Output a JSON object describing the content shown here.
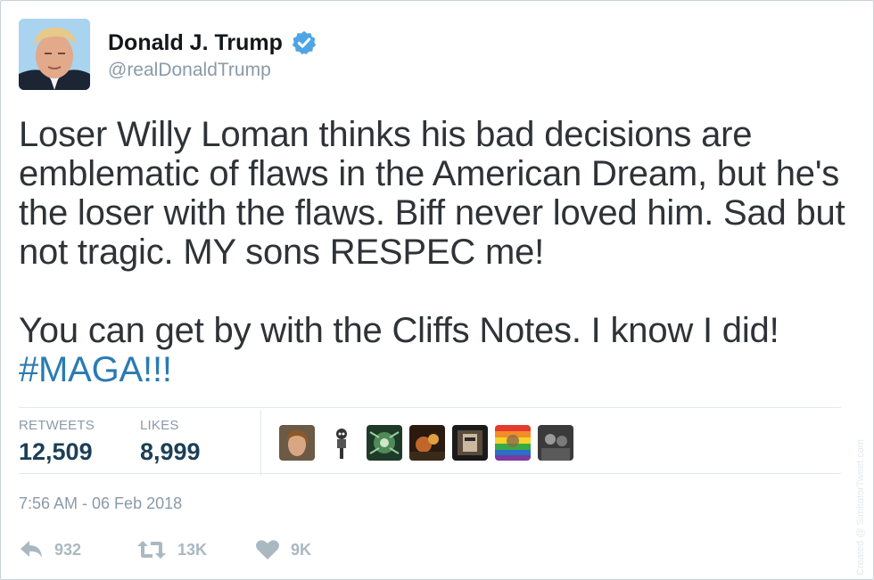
{
  "author": {
    "display_name": "Donald J. Trump",
    "handle": "@realDonaldTrump",
    "verified": true,
    "verified_icon": "verified-badge-icon",
    "verified_color": "#4ea4e4"
  },
  "tweet": {
    "paragraph1": "Loser Willy Loman thinks his bad decisions are emblematic of flaws in the American Dream, but he's the loser with the flaws. Biff never loved him. Sad but not tragic.  MY sons RESPEC me!",
    "paragraph2_text": "You can get by with the Cliffs Notes. I know I did!",
    "hashtag": "#MAGA!!!",
    "hashtag_color": "#2a7bb2"
  },
  "stats": {
    "retweets_label": "RETWEETS",
    "retweets_value": "12,509",
    "likes_label": "LIKES",
    "likes_value": "8,999"
  },
  "likers": [
    {
      "name": "liker-avatar-1"
    },
    {
      "name": "liker-avatar-2"
    },
    {
      "name": "liker-avatar-3"
    },
    {
      "name": "liker-avatar-4"
    },
    {
      "name": "liker-avatar-5"
    },
    {
      "name": "liker-avatar-6"
    },
    {
      "name": "liker-avatar-7"
    }
  ],
  "timestamp": "7:56 AM - 06 Feb 2018",
  "actions": {
    "reply": {
      "icon": "reply-icon",
      "count": "932"
    },
    "retweet": {
      "icon": "retweet-icon",
      "count": "13K"
    },
    "like": {
      "icon": "heart-icon",
      "count": "9K"
    }
  },
  "watermark": "Created @ SimitatorTweet.com"
}
